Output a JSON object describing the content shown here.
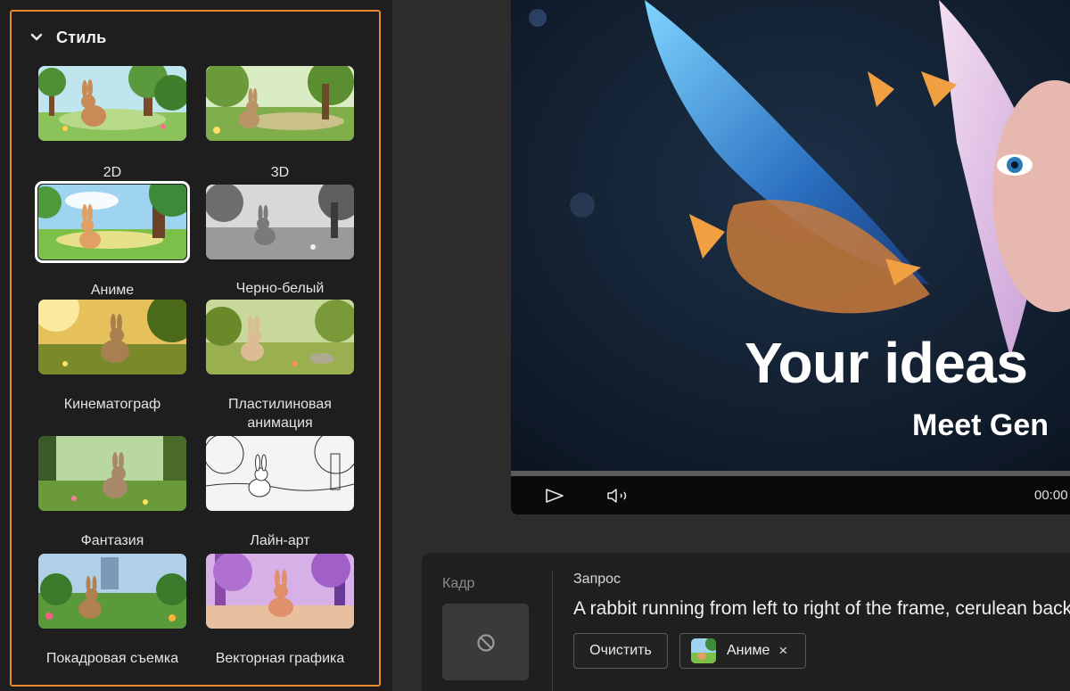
{
  "style_panel": {
    "title": "Стиль",
    "selected_index": 2,
    "tiles": [
      {
        "label": "2D"
      },
      {
        "label": "3D"
      },
      {
        "label": "Аниме"
      },
      {
        "label": "Черно-белый"
      },
      {
        "label": "Кинематограф"
      },
      {
        "label": "Пластилиновая анимация"
      },
      {
        "label": "Фантазия"
      },
      {
        "label": "Лайн-арт"
      },
      {
        "label": "Покадровая съемка"
      },
      {
        "label": "Векторная графика"
      }
    ]
  },
  "video": {
    "headline": "Your ideas",
    "subheadline": "Meet Gen",
    "time": "00:00"
  },
  "prompt": {
    "frame_label": "Кадр",
    "query_label": "Запрос",
    "query_text": "A rabbit running from left to right of the frame, cerulean backg",
    "clear_label": "Очистить",
    "chip_label": "Аниме",
    "chip_close": "×"
  },
  "colors": {
    "accent_border": "#e8892b",
    "panel_bg": "#1e1e1e",
    "page_bg": "#2c2c2c"
  }
}
